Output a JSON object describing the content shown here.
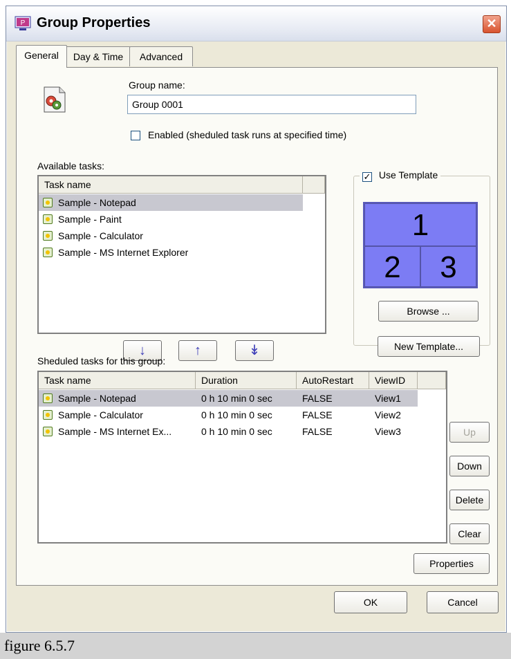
{
  "window": {
    "title": "Group Properties",
    "close_glyph": "✕"
  },
  "tabs": [
    {
      "label": "General"
    },
    {
      "label": "Day & Time"
    },
    {
      "label": "Advanced"
    }
  ],
  "general": {
    "group_name_label": "Group name:",
    "group_name_value": "Group 0001",
    "enabled_label": "Enabled (sheduled task runs at specified time)",
    "enabled_checked": false
  },
  "available": {
    "label": "Available tasks:",
    "column": "Task name",
    "rows": [
      "Sample - Notepad",
      "Sample - Paint",
      "Sample - Calculator",
      "Sample - MS Internet Explorer"
    ]
  },
  "move_buttons": {
    "down": "↓",
    "up": "↑",
    "all_down": "↡"
  },
  "template": {
    "label": "Use Template",
    "checked": true,
    "check_glyph": "✓",
    "cells": [
      "1",
      "2",
      "3"
    ],
    "browse_label": "Browse ...",
    "new_label": "New Template..."
  },
  "scheduled": {
    "label": "Sheduled tasks for this group:",
    "columns": [
      "Task name",
      "Duration",
      "AutoRestart",
      "ViewID"
    ],
    "rows": [
      {
        "name": "Sample - Notepad",
        "duration": "0 h 10 min 0 sec",
        "autorestart": "FALSE",
        "viewid": "View1"
      },
      {
        "name": "Sample - Calculator",
        "duration": "0 h 10 min 0 sec",
        "autorestart": "FALSE",
        "viewid": "View2"
      },
      {
        "name": "Sample - MS Internet Ex...",
        "duration": "0 h 10 min 0 sec",
        "autorestart": "FALSE",
        "viewid": "View3"
      }
    ]
  },
  "side_buttons": {
    "up": "Up",
    "down": "Down",
    "delete": "Delete",
    "clear": "Clear",
    "properties": "Properties"
  },
  "dialog_buttons": {
    "ok": "OK",
    "cancel": "Cancel"
  },
  "caption": "figure 6.5.7",
  "colors": {
    "template_blue": "#7c7cf4",
    "selected_row": "#c8c8d0",
    "close_red": "#d8532f"
  }
}
